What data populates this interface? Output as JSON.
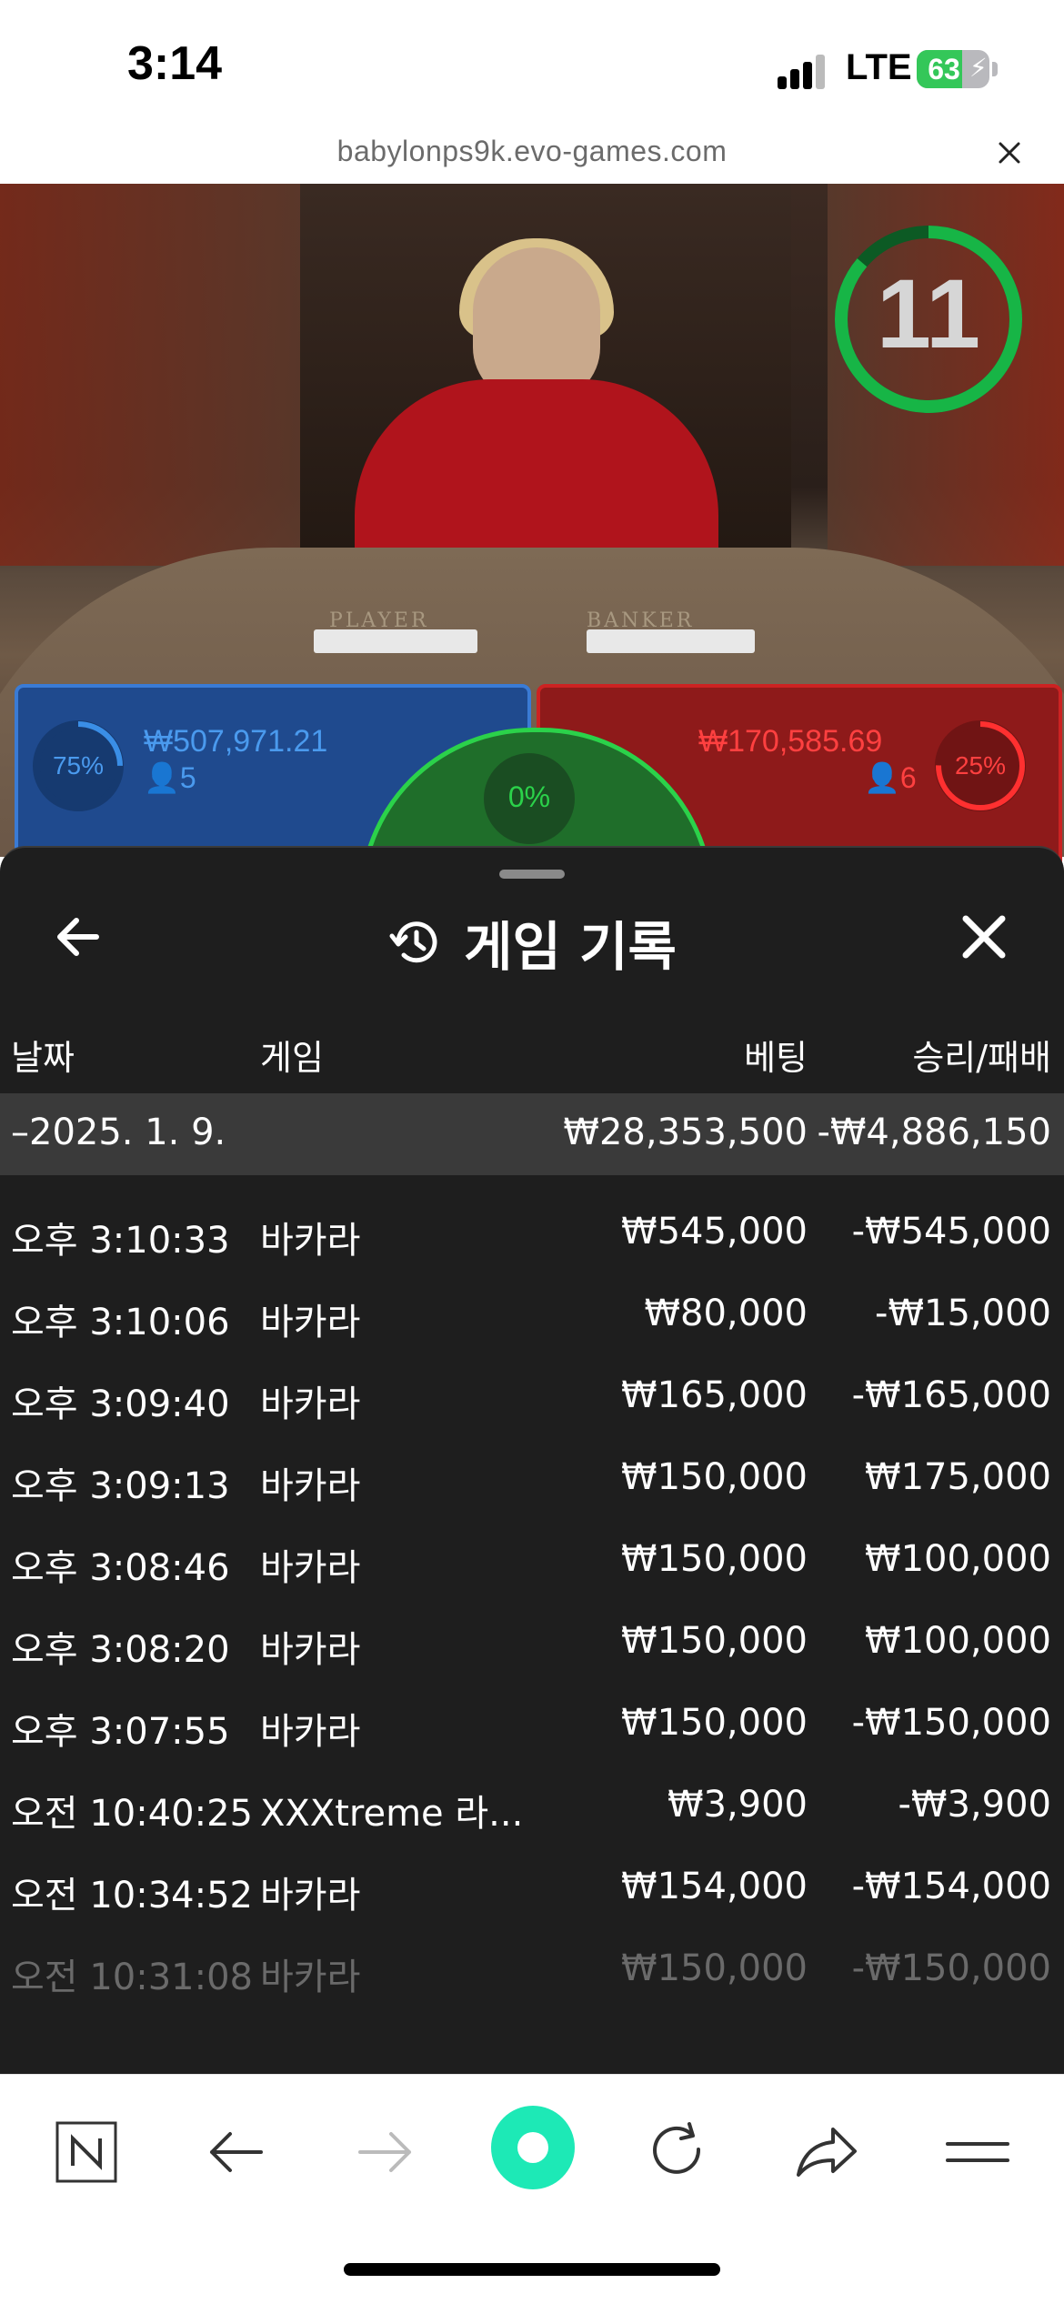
{
  "status_bar": {
    "time": "3:14",
    "network": "LTE",
    "battery": "63",
    "battery_level": 0.63
  },
  "browser": {
    "url": "babylonps9k.evo-games.com"
  },
  "live_game": {
    "countdown": "11",
    "table_labels": {
      "player": "PLAYER",
      "banker": "BANKER"
    },
    "player": {
      "percent": "75%",
      "amount": "₩507,971.21",
      "players": "5"
    },
    "banker": {
      "percent": "25%",
      "amount": "₩170,585.69",
      "players": "6"
    },
    "tie": {
      "percent": "0%"
    }
  },
  "sheet": {
    "title": "게임 기록",
    "columns": {
      "date": "날짜",
      "game": "게임",
      "bet": "베팅",
      "result": "승리/패배"
    },
    "group": {
      "date": "–2025. 1. 9.",
      "bet": "₩28,353,500",
      "result": "-₩4,886,150"
    },
    "rows": [
      {
        "time": "오후 3:10:33",
        "game": "바카라",
        "bet": "₩545,000",
        "result": "-₩545,000"
      },
      {
        "time": "오후 3:10:06",
        "game": "바카라",
        "bet": "₩80,000",
        "result": "-₩15,000"
      },
      {
        "time": "오후 3:09:40",
        "game": "바카라",
        "bet": "₩165,000",
        "result": "-₩165,000"
      },
      {
        "time": "오후 3:09:13",
        "game": "바카라",
        "bet": "₩150,000",
        "result": "₩175,000"
      },
      {
        "time": "오후 3:08:46",
        "game": "바카라",
        "bet": "₩150,000",
        "result": "₩100,000"
      },
      {
        "time": "오후 3:08:20",
        "game": "바카라",
        "bet": "₩150,000",
        "result": "₩100,000"
      },
      {
        "time": "오후 3:07:55",
        "game": "바카라",
        "bet": "₩150,000",
        "result": "-₩150,000"
      },
      {
        "time": "오전 10:40:25",
        "game": "XXXtreme 라...",
        "bet": "₩3,900",
        "result": "-₩3,900"
      },
      {
        "time": "오전 10:34:52",
        "game": "바카라",
        "bet": "₩154,000",
        "result": "-₩154,000"
      },
      {
        "time": "오전 10:31:08",
        "game": "바카라",
        "bet": "₩150,000",
        "result": "-₩150,000"
      }
    ]
  },
  "toolbar": {
    "icons": [
      "naver-n-icon",
      "back-arrow-icon",
      "forward-arrow-icon",
      "green-dot-icon",
      "reload-icon",
      "share-icon",
      "menu-icon"
    ],
    "accent": "#1de9b6"
  }
}
